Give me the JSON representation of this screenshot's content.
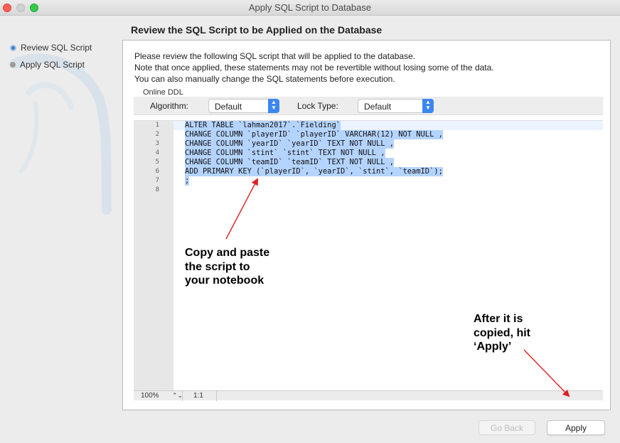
{
  "window": {
    "title": "Apply SQL Script to Database"
  },
  "steps": [
    {
      "label": "Review SQL Script",
      "active": true
    },
    {
      "label": "Apply SQL Script",
      "active": false
    }
  ],
  "page": {
    "title": "Review the SQL Script to be Applied on the Database"
  },
  "description": [
    "Please review the following SQL script that will be applied to the database.",
    "Note that once applied, these statements may not be revertible without losing some of the data.",
    "You can also manually change the SQL statements before execution."
  ],
  "online_ddl": {
    "label": "Online DDL",
    "algorithm_label": "Algorithm:",
    "algorithm_value": "Default",
    "lock_type_label": "Lock Type:",
    "lock_type_value": "Default"
  },
  "editor": {
    "line_numbers": [
      "1",
      "2",
      "3",
      "4",
      "5",
      "6",
      "7",
      "8"
    ],
    "lines": [
      "ALTER TABLE `lahman2017`.`Fielding`",
      "CHANGE COLUMN `playerID` `playerID` VARCHAR(12) NOT NULL ,",
      "CHANGE COLUMN `yearID` `yearID` TEXT NOT NULL ,",
      "CHANGE COLUMN `stint` `stint` TEXT NOT NULL ,",
      "CHANGE COLUMN `teamID` `teamID` TEXT NOT NULL ,",
      "ADD PRIMARY KEY (`playerID`, `yearID`, `stint`, `teamID`);",
      ";",
      ""
    ]
  },
  "statusbar": {
    "zoom": "100%",
    "position": "1:1"
  },
  "annotations": {
    "copy_note": [
      "Copy and paste",
      "the script to",
      "your notebook"
    ],
    "apply_note": [
      "After it is",
      "copied, hit",
      "‘Apply’"
    ]
  },
  "buttons": {
    "go_back": "Go Back",
    "apply": "Apply"
  },
  "colors": {
    "accent": "#3b86f0",
    "selection": "#b4d4ff",
    "arrow": "#e02020"
  }
}
